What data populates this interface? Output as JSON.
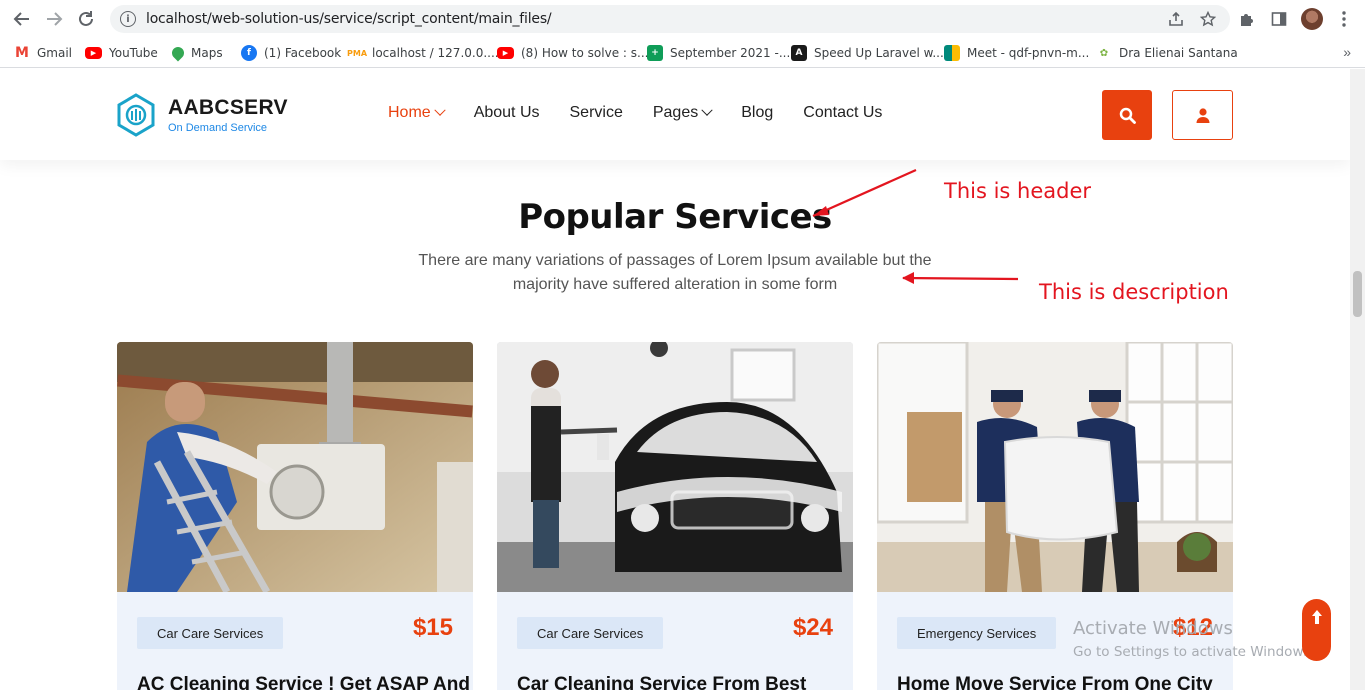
{
  "browser": {
    "url": "localhost/web-solution-us/service/script_content/main_files/",
    "bookmarks": [
      {
        "label": "Gmail",
        "icon": "gmail-icon",
        "color": "#ea4335"
      },
      {
        "label": "YouTube",
        "icon": "youtube-icon",
        "color": "#ff0000"
      },
      {
        "label": "Maps",
        "icon": "maps-icon",
        "color": "#34a853"
      },
      {
        "label": "(1) Facebook",
        "icon": "facebook-icon",
        "color": "#1877f2"
      },
      {
        "label": "localhost / 127.0.0....",
        "icon": "phpmyadmin-icon",
        "color": "#f89c0e"
      },
      {
        "label": "(8) How to solve : s...",
        "icon": "youtube-icon",
        "color": "#ff0000"
      },
      {
        "label": "September 2021 -...",
        "icon": "sheets-icon",
        "color": "#0f9d58"
      },
      {
        "label": "Speed Up Laravel w...",
        "icon": "laravel-icon",
        "color": "#b71c1c"
      },
      {
        "label": "Meet - qdf-pnvn-m...",
        "icon": "meet-icon",
        "color": "#00897b"
      },
      {
        "label": "Dra Elienai Santana",
        "icon": "site-icon",
        "color": "#7cb342"
      }
    ]
  },
  "site": {
    "brand": "AABCSERV",
    "tagline": "On Demand Service",
    "menu": [
      "Home",
      "About Us",
      "Service",
      "Pages",
      "Blog",
      "Contact Us"
    ],
    "accent": "#e8410f"
  },
  "section": {
    "title": "Popular Services",
    "description": "There are many variations of passages of Lorem Ipsum available but the majority have suffered alteration in some form"
  },
  "annotations": {
    "header_note": "This is header",
    "description_note": "This is description",
    "color": "#e3151f"
  },
  "cards": [
    {
      "category": "Car Care Services",
      "price": "$15",
      "title": "AC Cleaning Service ! Get ASAP And"
    },
    {
      "category": "Car Care Services",
      "price": "$24",
      "title": "Car Cleaning Service From Best"
    },
    {
      "category": "Emergency Services",
      "price": "$12",
      "title": "Home Move Service From One City"
    }
  ],
  "watermark": {
    "line1": "Activate Windows",
    "line2": "Go to Settings to activate Windows."
  }
}
